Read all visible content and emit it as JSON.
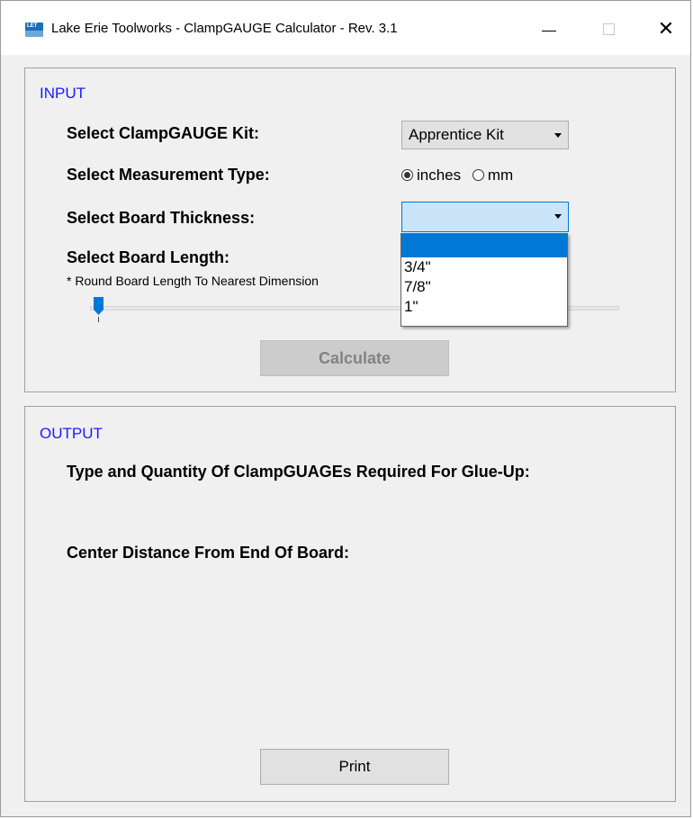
{
  "window": {
    "title": "Lake Erie Toolworks - ClampGAUGE Calculator - Rev. 3.1",
    "icon_text": "LET"
  },
  "input": {
    "section_title": "INPUT",
    "kit_label": "Select ClampGAUGE Kit:",
    "kit_value": "Apprentice Kit",
    "measure_label": "Select Measurement Type:",
    "measure_options": [
      "inches",
      "mm"
    ],
    "measure_selected": "inches",
    "thickness_label": "Select Board Thickness:",
    "thickness_value": "",
    "thickness_options": [
      "",
      "3/4\"",
      "7/8\"",
      "1\""
    ],
    "length_label": "Select Board Length:",
    "length_note": "* Round  Board Length To Nearest Dimension",
    "calculate_label": "Calculate"
  },
  "output": {
    "section_title": "OUTPUT",
    "type_quantity_label": "Type and Quantity Of ClampGUAGEs Required For Glue-Up:",
    "center_distance_label": "Center Distance From End Of Board:",
    "print_label": "Print"
  },
  "colors": {
    "section_title": "#1a1aff",
    "accent": "#0078d7",
    "dropdown_selected": "#0078d7"
  }
}
